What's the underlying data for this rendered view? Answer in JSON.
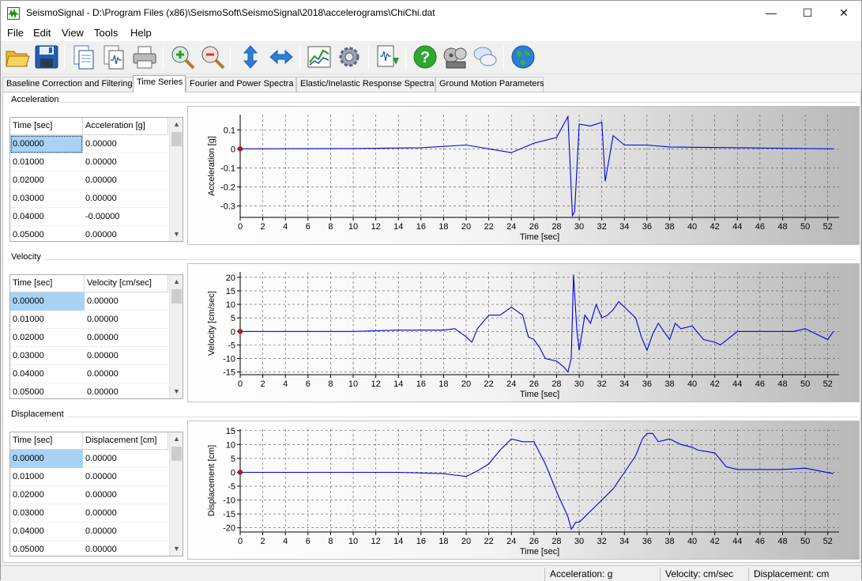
{
  "window": {
    "title": "SeismoSignal - D:\\Program Files (x86)\\SeismoSoft\\SeismoSignal\\2018\\accelerograms\\ChiChi.dat"
  },
  "menu": [
    {
      "label": "File"
    },
    {
      "label": "Edit"
    },
    {
      "label": "View"
    },
    {
      "label": "Tools"
    },
    {
      "label": "Help"
    }
  ],
  "toolbar": [
    {
      "name": "open-icon"
    },
    {
      "name": "save-icon"
    },
    {
      "name": "copy-icon"
    },
    {
      "name": "copy-signal-icon"
    },
    {
      "name": "print-icon"
    },
    {
      "name": "zoom-in-icon"
    },
    {
      "name": "zoom-out-icon"
    },
    {
      "name": "vertical-fit-icon"
    },
    {
      "name": "horizontal-fit-icon"
    },
    {
      "name": "chart-settings-icon"
    },
    {
      "name": "gear-icon"
    },
    {
      "name": "export-signal-icon"
    },
    {
      "name": "help-icon"
    },
    {
      "name": "tutorial-video-icon"
    },
    {
      "name": "feedback-icon"
    },
    {
      "name": "globe-icon"
    }
  ],
  "tabs": [
    {
      "label": "Baseline Correction and Filtering"
    },
    {
      "label": "Time Series"
    },
    {
      "label": "Fourier and Power Spectra"
    },
    {
      "label": "Elastic/Inelastic Response Spectra"
    },
    {
      "label": "Ground Motion Parameters"
    }
  ],
  "active_tab": "Time Series",
  "sections": [
    {
      "label": "Acceleration",
      "table": {
        "columns": [
          "Time [sec]",
          "Acceleration [g]"
        ],
        "rows": [
          [
            "0.00000",
            "0.00000"
          ],
          [
            "0.01000",
            "0.00000"
          ],
          [
            "0.02000",
            "0.00000"
          ],
          [
            "0.03000",
            "0.00000"
          ],
          [
            "0.04000",
            "-0.00000"
          ],
          [
            "0.05000",
            "0.00000"
          ]
        ]
      }
    },
    {
      "label": "Velocity",
      "table": {
        "columns": [
          "Time [sec]",
          "Velocity [cm/sec]"
        ],
        "rows": [
          [
            "0.00000",
            "0.00000"
          ],
          [
            "0.01000",
            "0.00000"
          ],
          [
            "0.02000",
            "0.00000"
          ],
          [
            "0.03000",
            "0.00000"
          ],
          [
            "0.04000",
            "0.00000"
          ],
          [
            "0.05000",
            "0.00000"
          ]
        ]
      }
    },
    {
      "label": "Displacement",
      "table": {
        "columns": [
          "Time [sec]",
          "Displacement [cm]"
        ],
        "rows": [
          [
            "0.00000",
            "0.00000"
          ],
          [
            "0.01000",
            "0.00000"
          ],
          [
            "0.02000",
            "0.00000"
          ],
          [
            "0.03000",
            "0.00000"
          ],
          [
            "0.04000",
            "0.00000"
          ],
          [
            "0.05000",
            "0.00000"
          ]
        ]
      }
    }
  ],
  "chart_data": [
    {
      "type": "line",
      "xlabel": "Time [sec]",
      "ylabel": "Acceleration [g]",
      "xlim": [
        0,
        53
      ],
      "ylim": [
        -0.36,
        0.18
      ],
      "xticks": [
        0,
        2,
        4,
        6,
        8,
        10,
        12,
        14,
        16,
        18,
        20,
        22,
        24,
        26,
        28,
        30,
        32,
        34,
        36,
        38,
        40,
        42,
        44,
        46,
        48,
        50,
        52
      ],
      "yticks": [
        0.1,
        0,
        -0.1,
        -0.2,
        -0.3
      ],
      "ytick_labels": [
        "0.1",
        "0",
        "-0.1",
        "-0.2",
        "-0.3"
      ],
      "grid": true,
      "color": "#0000e0",
      "series": [
        {
          "x": [
            0,
            10,
            16,
            20,
            24,
            26,
            28,
            29,
            29.4,
            29.6,
            30,
            31,
            32,
            32.3,
            33,
            34,
            36,
            38,
            45,
            52.5
          ],
          "y": [
            0,
            0.002,
            0.006,
            0.02,
            -0.02,
            0.03,
            0.06,
            0.17,
            -0.35,
            -0.33,
            0.13,
            0.12,
            0.14,
            -0.17,
            0.07,
            0.02,
            0.02,
            0.01,
            0.005,
            0.0
          ]
        }
      ]
    },
    {
      "type": "line",
      "xlabel": "Time [sec]",
      "ylabel": "Velocity [cm/sec]",
      "xlim": [
        0,
        53
      ],
      "ylim": [
        -16,
        22
      ],
      "xticks": [
        0,
        2,
        4,
        6,
        8,
        10,
        12,
        14,
        16,
        18,
        20,
        22,
        24,
        26,
        28,
        30,
        32,
        34,
        36,
        38,
        40,
        42,
        44,
        46,
        48,
        50,
        52
      ],
      "yticks": [
        20,
        15,
        10,
        5,
        0,
        -5,
        -10,
        -15
      ],
      "ytick_labels": [
        "20",
        "15",
        "10",
        "5",
        "0",
        "-5",
        "-10",
        "-15"
      ],
      "grid": true,
      "color": "#0000e0",
      "series": [
        {
          "x": [
            0,
            10,
            14,
            18,
            19,
            20,
            20.5,
            21,
            22,
            23,
            24,
            25,
            25.5,
            26,
            26.5,
            27,
            28,
            28.6,
            29,
            29.3,
            29.5,
            29.8,
            30,
            30.5,
            31,
            31.5,
            32,
            32.5,
            33,
            33.5,
            34,
            35,
            35.5,
            36,
            36.5,
            37,
            37.5,
            38,
            38.5,
            39,
            40,
            41,
            42,
            42.5,
            44,
            46,
            48,
            49,
            50,
            51,
            52,
            52.5
          ],
          "y": [
            0,
            0,
            0.5,
            0.5,
            1,
            -2,
            -4,
            1,
            6,
            6,
            9,
            6,
            -2,
            -3,
            -6,
            -10,
            -11,
            -13,
            -15,
            -10,
            21,
            0,
            -7,
            6,
            3,
            10,
            5,
            6,
            8,
            11,
            9,
            5,
            -2,
            -7,
            -1,
            3,
            0,
            -3,
            3,
            1,
            2,
            -3,
            -4,
            -5,
            0,
            0,
            0,
            0,
            1,
            -1,
            -3,
            0
          ]
        }
      ]
    },
    {
      "type": "line",
      "xlabel": "Time [sec]",
      "ylabel": "Displacement [cm]",
      "xlim": [
        0,
        53
      ],
      "ylim": [
        -21.5,
        15.5
      ],
      "xticks": [
        0,
        2,
        4,
        6,
        8,
        10,
        12,
        14,
        16,
        18,
        20,
        22,
        24,
        26,
        28,
        30,
        32,
        34,
        36,
        38,
        40,
        42,
        44,
        46,
        48,
        50,
        52
      ],
      "yticks": [
        15,
        10,
        5,
        0,
        -5,
        -10,
        -15,
        -20
      ],
      "ytick_labels": [
        "15",
        "10",
        "5",
        "0",
        "-5",
        "-10",
        "-15",
        "-20"
      ],
      "grid": true,
      "color": "#0000e0",
      "series": [
        {
          "x": [
            0,
            8,
            14,
            18,
            19,
            20,
            21,
            22,
            23,
            24,
            25,
            26,
            27,
            28,
            29,
            29.3,
            29.7,
            30,
            30.5,
            31,
            32,
            33,
            34,
            35,
            35.6,
            36,
            36.5,
            37,
            38,
            39,
            40,
            40.5,
            42,
            43,
            44,
            48,
            50,
            52.5
          ],
          "y": [
            0,
            0,
            0,
            -0.5,
            -1,
            -1.5,
            0.5,
            3,
            8,
            12,
            11,
            11,
            3,
            -7,
            -16,
            -20.5,
            -18,
            -18,
            -16,
            -14,
            -10,
            -6,
            0,
            6,
            12,
            14,
            14,
            11,
            12,
            10,
            9,
            8,
            7,
            2,
            1,
            1,
            1.5,
            -0.5
          ]
        }
      ]
    }
  ],
  "status": [
    {
      "text": "Acceleration: g"
    },
    {
      "text": "Velocity: cm/sec"
    },
    {
      "text": "Displacement: cm"
    }
  ]
}
